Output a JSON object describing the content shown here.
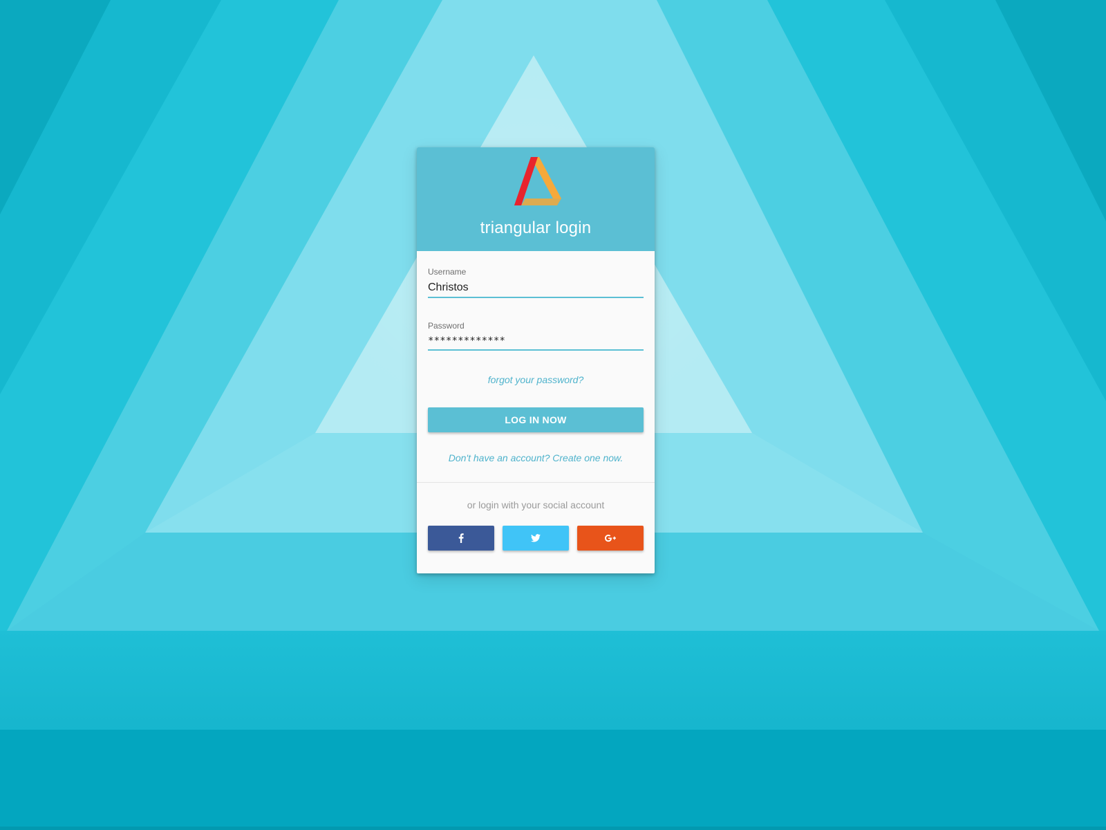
{
  "header": {
    "title": "triangular login",
    "logo_icon": "triangle-logo-icon",
    "colors": {
      "background": "#5bbfd4",
      "logo_red": "#e8232d",
      "logo_orange": "#f6a93a",
      "logo_teal": "#49b0c5"
    }
  },
  "form": {
    "username": {
      "label": "Username",
      "value": "Christos"
    },
    "password": {
      "label": "Password",
      "value": "*************"
    },
    "forgot_link": "forgot your password?",
    "submit_label": "LOG IN NOW",
    "signup_link": "Don't have an account? Create one now."
  },
  "social": {
    "caption": "or login with your social account",
    "buttons": [
      {
        "icon": "facebook-icon",
        "color": "#3b5998"
      },
      {
        "icon": "twitter-icon",
        "color": "#40c4f7"
      },
      {
        "icon": "google-plus-icon",
        "color": "#e8541a"
      }
    ]
  },
  "theme": {
    "accent": "#5bbfd4",
    "link_color": "#4fb3cc"
  }
}
